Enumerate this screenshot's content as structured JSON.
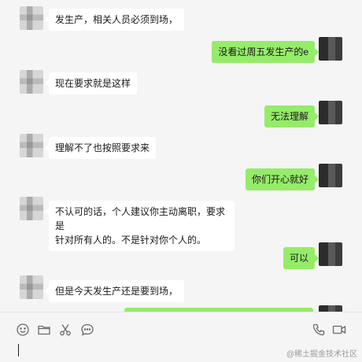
{
  "messages": [
    {
      "side": "left",
      "text": "发生产，相关人员必须到场，"
    },
    {
      "side": "right",
      "text": "没看过周五发生产的e"
    },
    {
      "side": "left",
      "text": "现在要求就是这样"
    },
    {
      "side": "right",
      "text": "无法理解"
    },
    {
      "side": "left",
      "text": "理解不了也按照要求来"
    },
    {
      "side": "right",
      "text": "你们开心就好"
    },
    {
      "side": "left",
      "line1": "不认可的话，个人建议你主动离职，要求是",
      "line2": "针对所有人的。不是针对你个人的。"
    },
    {
      "side": "right",
      "text": "可以"
    },
    {
      "side": "left",
      "text": "但是今天发生产还是要到场，"
    }
  ],
  "toolbar": {
    "icons": [
      "emoji-icon",
      "folder-icon",
      "scissors-icon",
      "chat-bubble-icon",
      "phone-icon",
      "video-icon"
    ]
  },
  "watermark": "@稀土掘金技术社区"
}
